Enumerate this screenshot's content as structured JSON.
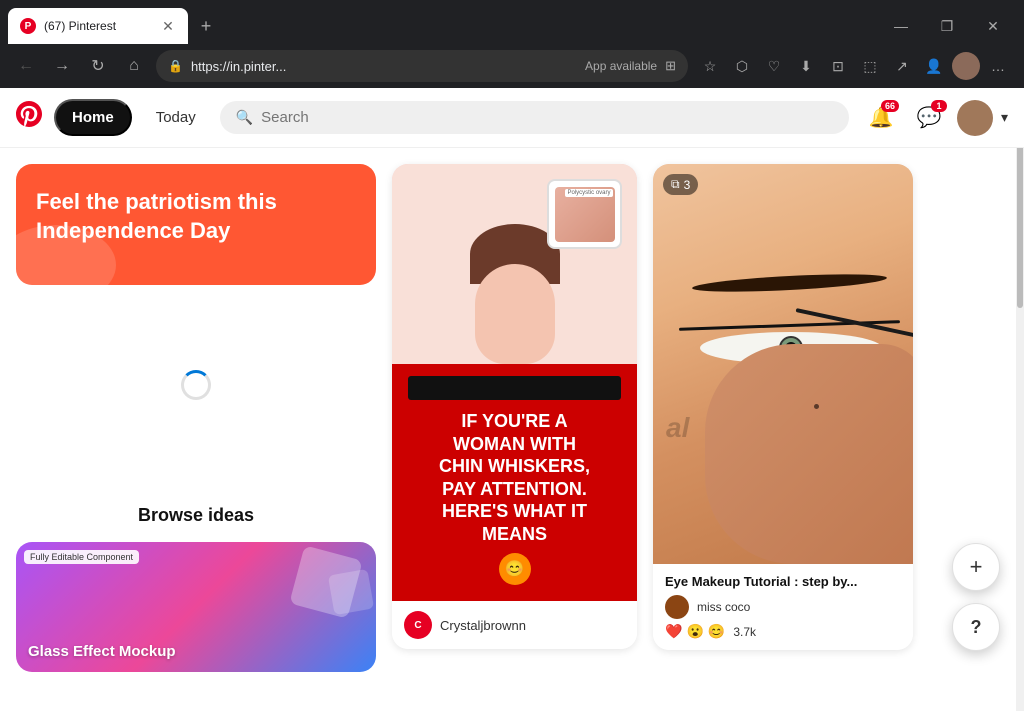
{
  "browser": {
    "tab_title": "(67) Pinterest",
    "tab_favicon": "P",
    "address": "https://in.pinter...",
    "app_available_label": "App available",
    "new_tab_label": "+",
    "win_minimize": "—",
    "win_maximize": "❐",
    "win_close": "✕"
  },
  "pinterest": {
    "logo_label": "P",
    "nav_home": "Home",
    "nav_today": "Today",
    "search_placeholder": "Search",
    "notification_count": "66",
    "message_count": "1",
    "patriotism_text": "Feel the patriotism this Independence Day",
    "browse_title": "Browse ideas",
    "browse_card_badge": "Fully Editable Component",
    "browse_card_text": "Glass Effect Mockup",
    "pin1": {
      "text_lines": [
        "IF YOU'RE A",
        "WOMAN WITH",
        "CHIN WHISKERS,",
        "PAY ATTENTION.",
        "HERE'S WHAT IT",
        "MEANS"
      ],
      "username": "Crystaljbrownn",
      "avatar_letter": "C"
    },
    "pin2": {
      "count": "3",
      "title": "Eye Makeup Tutorial : step by...",
      "username": "miss coco",
      "reactions": [
        "❤️",
        "😮",
        "😊"
      ],
      "reaction_count": "3.7k"
    }
  }
}
